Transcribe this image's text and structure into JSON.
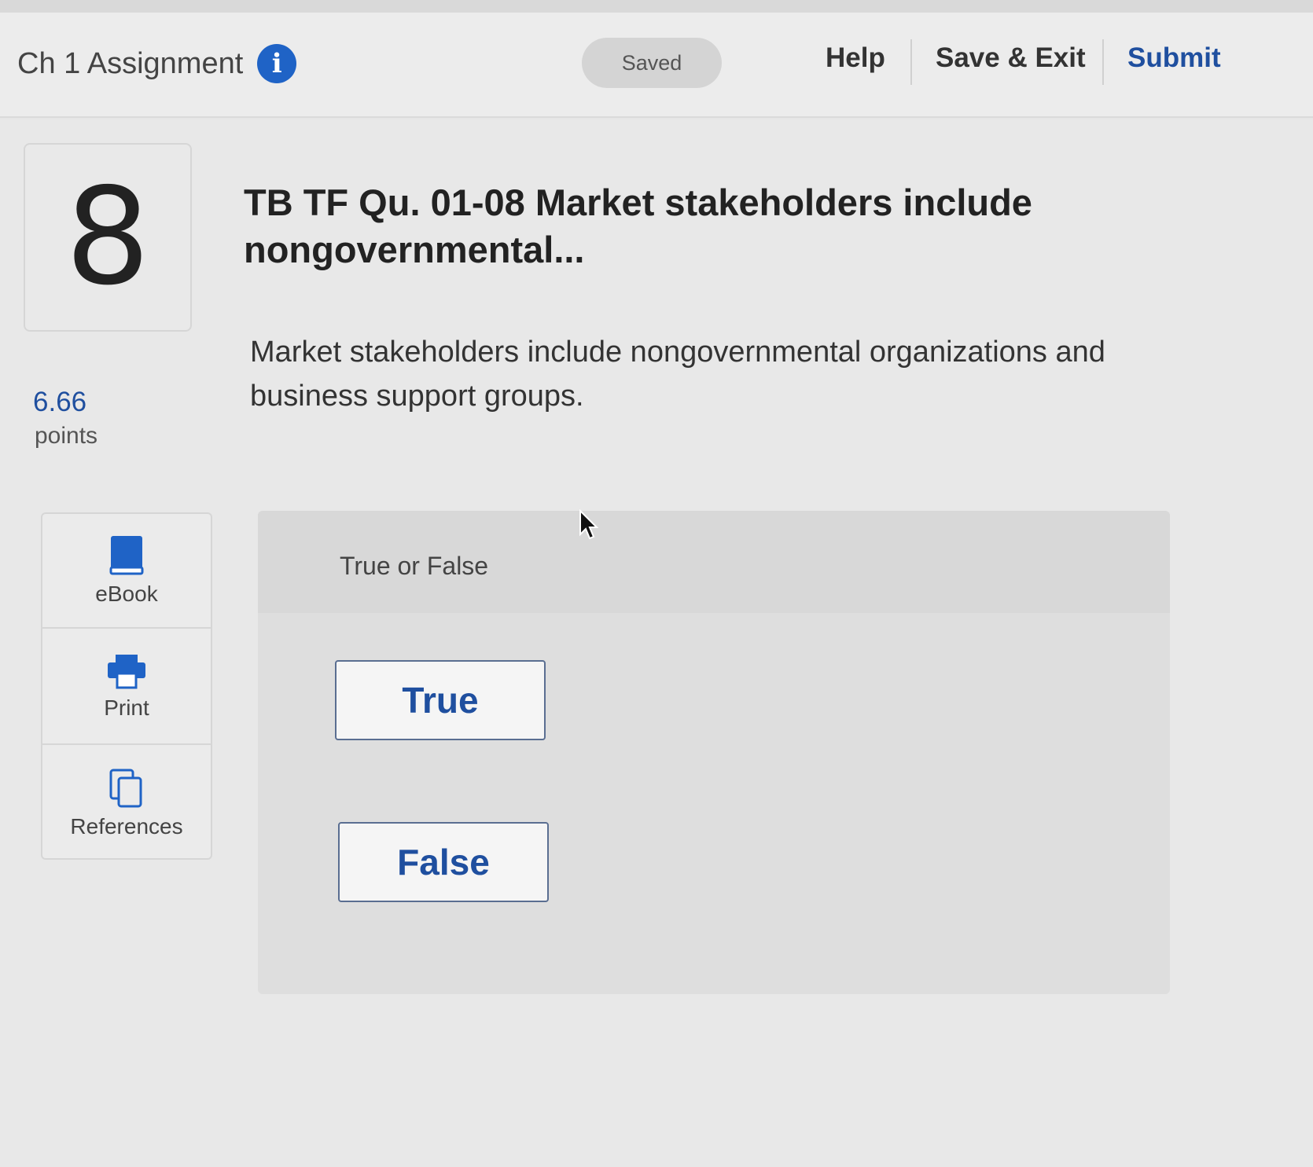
{
  "header": {
    "assignment_title": "Ch 1 Assignment",
    "status": "Saved",
    "help_label": "Help",
    "save_exit_label": "Save & Exit",
    "submit_label": "Submit"
  },
  "question": {
    "number": "8",
    "points_value": "6.66",
    "points_label": "points",
    "title": "TB TF Qu. 01-08 Market stakeholders include nongovernmental...",
    "text": "Market stakeholders include nongovernmental organizations and business support groups."
  },
  "tools": [
    {
      "label": "eBook",
      "icon": "book-icon"
    },
    {
      "label": "Print",
      "icon": "printer-icon"
    },
    {
      "label": "References",
      "icon": "copy-documents-icon"
    }
  ],
  "answer": {
    "type_label": "True or False",
    "options": [
      "True",
      "False"
    ]
  },
  "colors": {
    "accent": "#1f63c6",
    "link_text": "#1f4f9f"
  }
}
